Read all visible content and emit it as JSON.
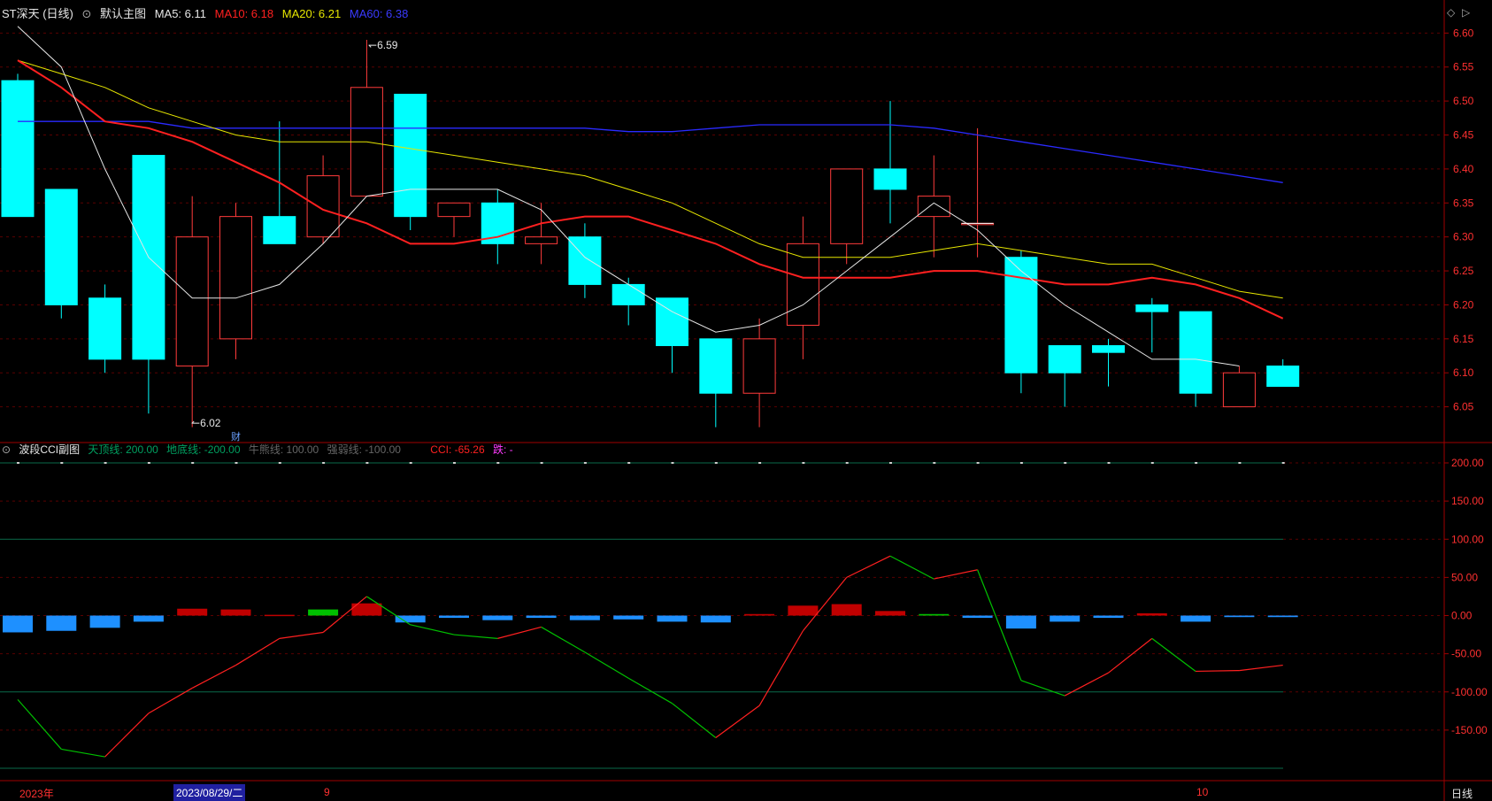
{
  "main_header": {
    "title": "ST深天 (日线)",
    "indicator_name": "默认主图",
    "ma5_label": "MA5: 6.11",
    "ma10_label": "MA10: 6.18",
    "ma20_label": "MA20: 6.21",
    "ma60_label": "MA60: 6.38"
  },
  "sub_header": {
    "indicator_name": "波段CCI副图",
    "top_line": "天顶线: 200.00",
    "bottom_line": "地底线: -200.00",
    "bull_line": "牛熊线: 100.00",
    "weak_line": "强弱线: -100.00",
    "cci_label": "CCI: -65.26",
    "fall_label": "跌: -"
  },
  "colors": {
    "up": "#ff3b3b",
    "down": "#00ffff",
    "ma5": "#e6e6e6",
    "ma10": "#ff2020",
    "ma20": "#e6e600",
    "ma60": "#2a2aff",
    "axis": "#a00000",
    "grid": "#5a0000"
  },
  "bottom_axis": {
    "year_label": "2023年",
    "date_cursor_label": "2023/08/29/二",
    "sep_label": "9",
    "oct_label": "10",
    "period_label": "日线"
  },
  "markers": {
    "high_label": "6.59",
    "low_label": "6.02",
    "finance_label": "财"
  },
  "chart_data": [
    {
      "type": "candlestick",
      "ylim": [
        6.0,
        6.62
      ],
      "y_ticks": [
        "6.60",
        "6.55",
        "6.50",
        "6.45",
        "6.40",
        "6.35",
        "6.30",
        "6.25",
        "6.20",
        "6.15",
        "6.10",
        "6.05"
      ],
      "candles": [
        {
          "o": 6.53,
          "c": 6.33,
          "h": 6.54,
          "l": 6.33
        },
        {
          "o": 6.37,
          "c": 6.2,
          "h": 6.37,
          "l": 6.18
        },
        {
          "o": 6.21,
          "c": 6.12,
          "h": 6.23,
          "l": 6.1
        },
        {
          "o": 6.42,
          "c": 6.12,
          "h": 6.42,
          "l": 6.04
        },
        {
          "o": 6.11,
          "c": 6.3,
          "h": 6.36,
          "l": 6.02
        },
        {
          "o": 6.15,
          "c": 6.33,
          "h": 6.35,
          "l": 6.12
        },
        {
          "o": 6.33,
          "c": 6.29,
          "h": 6.47,
          "l": 6.29
        },
        {
          "o": 6.3,
          "c": 6.39,
          "h": 6.42,
          "l": 6.29
        },
        {
          "o": 6.36,
          "c": 6.52,
          "h": 6.59,
          "l": 6.36
        },
        {
          "o": 6.51,
          "c": 6.33,
          "h": 6.51,
          "l": 6.31
        },
        {
          "o": 6.33,
          "c": 6.35,
          "h": 6.35,
          "l": 6.3
        },
        {
          "o": 6.35,
          "c": 6.29,
          "h": 6.37,
          "l": 6.26
        },
        {
          "o": 6.29,
          "c": 6.3,
          "h": 6.35,
          "l": 6.26
        },
        {
          "o": 6.3,
          "c": 6.23,
          "h": 6.32,
          "l": 6.21
        },
        {
          "o": 6.23,
          "c": 6.2,
          "h": 6.24,
          "l": 6.17
        },
        {
          "o": 6.21,
          "c": 6.14,
          "h": 6.21,
          "l": 6.1
        },
        {
          "o": 6.15,
          "c": 6.07,
          "h": 6.15,
          "l": 6.02
        },
        {
          "o": 6.07,
          "c": 6.15,
          "h": 6.18,
          "l": 6.02
        },
        {
          "o": 6.17,
          "c": 6.29,
          "h": 6.33,
          "l": 6.12
        },
        {
          "o": 6.29,
          "c": 6.4,
          "h": 6.4,
          "l": 6.26
        },
        {
          "o": 6.4,
          "c": 6.37,
          "h": 6.5,
          "l": 6.32
        },
        {
          "o": 6.33,
          "c": 6.36,
          "h": 6.42,
          "l": 6.27
        },
        {
          "o": 6.32,
          "c": 6.32,
          "h": 6.46,
          "l": 6.27
        },
        {
          "o": 6.27,
          "c": 6.1,
          "h": 6.28,
          "l": 6.07
        },
        {
          "o": 6.14,
          "c": 6.1,
          "h": 6.14,
          "l": 6.05
        },
        {
          "o": 6.14,
          "c": 6.13,
          "h": 6.15,
          "l": 6.08
        },
        {
          "o": 6.2,
          "c": 6.19,
          "h": 6.21,
          "l": 6.13
        },
        {
          "o": 6.19,
          "c": 6.07,
          "h": 6.19,
          "l": 6.05
        },
        {
          "o": 6.05,
          "c": 6.1,
          "h": 6.11,
          "l": 6.05
        },
        {
          "o": 6.11,
          "c": 6.08,
          "h": 6.12,
          "l": 6.08
        }
      ],
      "ma5": [
        6.61,
        6.55,
        6.4,
        6.27,
        6.21,
        6.21,
        6.23,
        6.29,
        6.36,
        6.37,
        6.37,
        6.37,
        6.34,
        6.27,
        6.23,
        6.19,
        6.16,
        6.17,
        6.2,
        6.25,
        6.3,
        6.35,
        6.31,
        6.25,
        6.2,
        6.16,
        6.12,
        6.12,
        6.11
      ],
      "ma10": [
        6.56,
        6.52,
        6.47,
        6.46,
        6.44,
        6.41,
        6.38,
        6.34,
        6.32,
        6.29,
        6.29,
        6.3,
        6.32,
        6.33,
        6.33,
        6.31,
        6.29,
        6.26,
        6.24,
        6.24,
        6.24,
        6.25,
        6.25,
        6.24,
        6.23,
        6.23,
        6.24,
        6.23,
        6.21,
        6.18
      ],
      "ma20": [
        6.56,
        6.54,
        6.52,
        6.49,
        6.47,
        6.45,
        6.44,
        6.44,
        6.44,
        6.43,
        6.42,
        6.41,
        6.4,
        6.39,
        6.37,
        6.35,
        6.32,
        6.29,
        6.27,
        6.27,
        6.27,
        6.28,
        6.29,
        6.28,
        6.27,
        6.26,
        6.26,
        6.24,
        6.22,
        6.21
      ],
      "ma60": [
        6.47,
        6.47,
        6.47,
        6.47,
        6.46,
        6.46,
        6.46,
        6.46,
        6.46,
        6.46,
        6.46,
        6.46,
        6.46,
        6.46,
        6.455,
        6.455,
        6.46,
        6.465,
        6.465,
        6.465,
        6.465,
        6.46,
        6.45,
        6.44,
        6.43,
        6.42,
        6.41,
        6.4,
        6.39,
        6.38
      ]
    },
    {
      "type": "line+bar",
      "ylim": [
        -200,
        200
      ],
      "y_ticks": [
        "200.00",
        "150.00",
        "100.00",
        "50.00",
        "0.00",
        "-50.00",
        "-100.00",
        "-150.00"
      ],
      "reference_lines": [
        200,
        100,
        -100,
        -200
      ],
      "cci": [
        -110,
        -175,
        -185,
        -128,
        -95,
        -65,
        -30,
        -22,
        25,
        -12,
        -25,
        -30,
        -15,
        -48,
        -82,
        -115,
        -160,
        -118,
        -20,
        50,
        78,
        48,
        60,
        -85,
        -105,
        -75,
        -30,
        -73,
        -72,
        -65
      ],
      "bars": [
        -22,
        -20,
        -16,
        -8,
        9,
        8,
        1,
        8,
        16,
        -9,
        -3,
        -6,
        -3,
        -6,
        -5,
        -8,
        -9,
        2,
        13,
        15,
        6,
        2,
        -3,
        -17,
        -8,
        -3,
        3,
        -8,
        -2,
        -2
      ]
    }
  ]
}
